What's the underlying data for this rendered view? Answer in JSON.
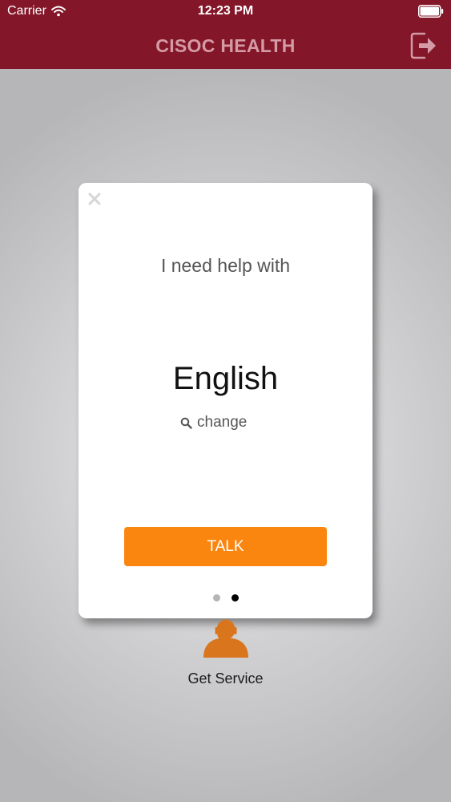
{
  "status_bar": {
    "carrier": "Carrier",
    "time": "12:23 PM",
    "wifi_icon": "wifi-icon",
    "battery_icon": "battery-full-icon"
  },
  "header": {
    "title": "CISOC HEALTH",
    "logout_icon": "logout-icon",
    "background_color": "#831628"
  },
  "dialog": {
    "close_icon": "close-icon",
    "prompt": "I need help with",
    "language": "English",
    "change_label": "change",
    "search_icon": "search-icon",
    "talk_button_label": "TALK",
    "talk_button_color": "#fb860f",
    "page_indicator": {
      "total_pages": 2,
      "current_page": 2,
      "active_color": "#000000",
      "inactive_color": "#b5b5b5"
    }
  },
  "home": {
    "service_icon": "agent-headset-icon",
    "service_label": "Get Service",
    "accent_color": "#d9751d"
  }
}
